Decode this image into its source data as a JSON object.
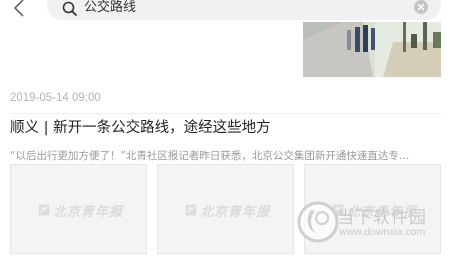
{
  "header": {
    "search_query": "公交路线",
    "back_icon": "chevron-left-icon",
    "search_icon": "search-icon",
    "clear_icon": "clear-icon"
  },
  "article": {
    "date": "2019-05-14 09:00",
    "title": "顺义 | 新开一条公交路线，途经这些地方",
    "summary": "“以后出行更加方便了！”北青社区报记者昨日获悉，北京公交集团新开通快速直达专…",
    "thumbnails": [
      {
        "logo_text": "北京青年报"
      },
      {
        "logo_text": "北京青年报"
      },
      {
        "logo_text": "北京青年报"
      }
    ]
  },
  "watermark": {
    "name": "当下软件园",
    "url": "www.downxia.com"
  },
  "colors": {
    "search_bg": "#f1f1f3",
    "muted_text": "#9a9a9a",
    "title_text": "#222222"
  }
}
